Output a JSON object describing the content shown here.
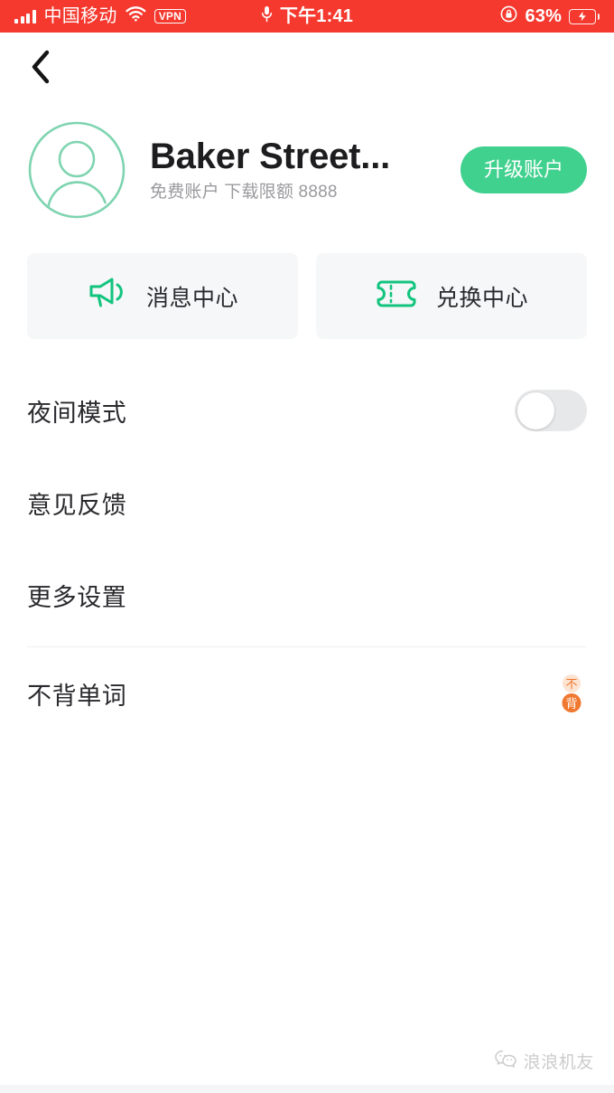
{
  "statusbar": {
    "carrier": "中国移动",
    "vpn_label": "VPN",
    "time": "下午1:41",
    "battery_percent": "63%",
    "battery_level": 63,
    "icons": [
      "signal-bars-icon",
      "wifi-icon",
      "vpn-badge",
      "microphone-icon",
      "rotation-lock-icon",
      "battery-charging-icon"
    ],
    "background_color": "#F5392E"
  },
  "navbar": {
    "back_label": "返回"
  },
  "profile": {
    "username": "Baker Street...",
    "subtitle": "免费账户 下载限额 8888",
    "upgrade_label": "升级账户",
    "accent_color": "#41D18F",
    "avatar_color": "#7FD4B0"
  },
  "quick_cards": [
    {
      "label": "消息中心",
      "icon": "megaphone-icon",
      "color": "#12C47E"
    },
    {
      "label": "兑换中心",
      "icon": "ticket-icon",
      "color": "#12C47E"
    }
  ],
  "settings": [
    {
      "label": "夜间模式",
      "control": "toggle",
      "enabled": false
    },
    {
      "label": "意见反馈",
      "control": "none"
    },
    {
      "label": "更多设置",
      "control": "none"
    }
  ],
  "apps": [
    {
      "label": "不背单词",
      "logo_top": "不",
      "logo_bottom": "背",
      "color": "#F0782F"
    }
  ],
  "watermark": {
    "text": "浪浪机友",
    "icon": "wechat-icon"
  }
}
